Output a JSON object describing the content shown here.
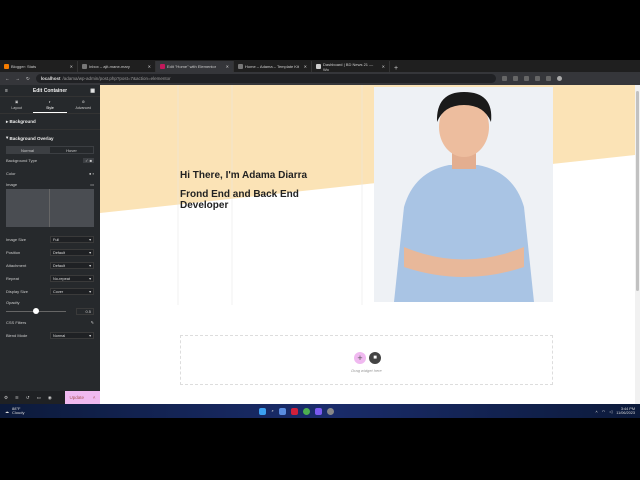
{
  "browser": {
    "tabs": [
      {
        "label": "Blogger: Stats",
        "color": "#f57c00"
      },
      {
        "label": "Inbox – ajit-mane-mary",
        "color": "#777"
      },
      {
        "label": "Edit \"Home\" with Elementor",
        "color": "#c2185b",
        "active": true
      },
      {
        "label": "Home – Adama – Template Kit",
        "color": "#777"
      },
      {
        "label": "Dashboard | BD News 21 — Wo",
        "color": "#ccc"
      }
    ],
    "url_host": "localhost",
    "url_path": "/adama/wp-admin/post.php?post=7&action=elementor",
    "new_tab": "+"
  },
  "sidebar": {
    "title": "Edit Container",
    "tabs": [
      {
        "label": "Layout",
        "icon": "layout-icon"
      },
      {
        "label": "Style",
        "icon": "style-icon"
      },
      {
        "label": "Advanced",
        "icon": "gear-icon"
      }
    ],
    "sections": {
      "background": "Background",
      "overlay": "Background Overlay"
    },
    "state_tabs": [
      "Normal",
      "Hover"
    ],
    "fields": {
      "bg_type": "Background Type",
      "color": "Color",
      "image": "Image",
      "image_size": "Image Size",
      "image_size_val": "Full",
      "position": "Position",
      "position_val": "Default",
      "attachment": "Attachment",
      "attachment_val": "Default",
      "repeat": "Repeat",
      "repeat_val": "No-repeat",
      "display_size": "Display Size",
      "display_size_val": "Cover",
      "opacity": "Opacity",
      "opacity_val": "0.5",
      "css_filters": "CSS Filters",
      "blend_mode": "Blend Mode",
      "blend_mode_val": "Normal"
    },
    "opacity_fraction": 0.5,
    "update": "Update"
  },
  "hero": {
    "greeting": "Hi There, I'm Adama Diarra",
    "role": "Frond End and Back End Developer"
  },
  "empty": {
    "hint": "Drag widget here"
  },
  "taskbar": {
    "weather_temp": "88°F",
    "weather_desc": "Cloudy",
    "time": "3:44 PM",
    "date": "11/06/2023"
  },
  "colors": {
    "accent": "#f0b9f0",
    "hero_bg": "#fbe3b6",
    "sidebar": "#26292c"
  }
}
